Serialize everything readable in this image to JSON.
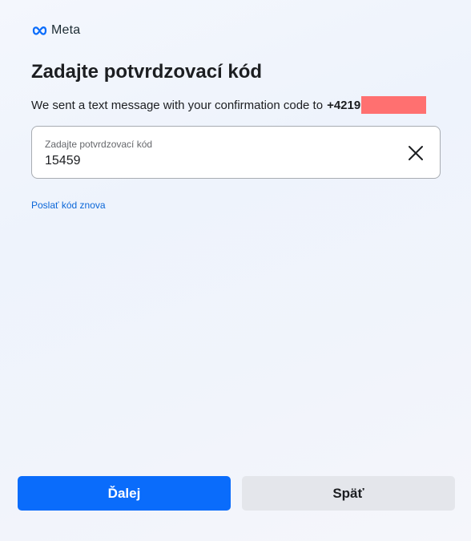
{
  "logo": {
    "text": "Meta"
  },
  "title": "Zadajte potvrdzovací kód",
  "subtitle": {
    "message": "We sent a text message with your confirmation code to",
    "phone_prefix": "+4219"
  },
  "code_field": {
    "label": "Zadajte potvrdzovací kód",
    "value": "15459"
  },
  "resend_link": "Poslať kód znova",
  "buttons": {
    "next": "Ďalej",
    "back": "Späť"
  },
  "colors": {
    "primary": "#0a6cfb",
    "link": "#0a66d8",
    "secondary_button": "#e4e6eb",
    "redaction": "#ff7070"
  }
}
